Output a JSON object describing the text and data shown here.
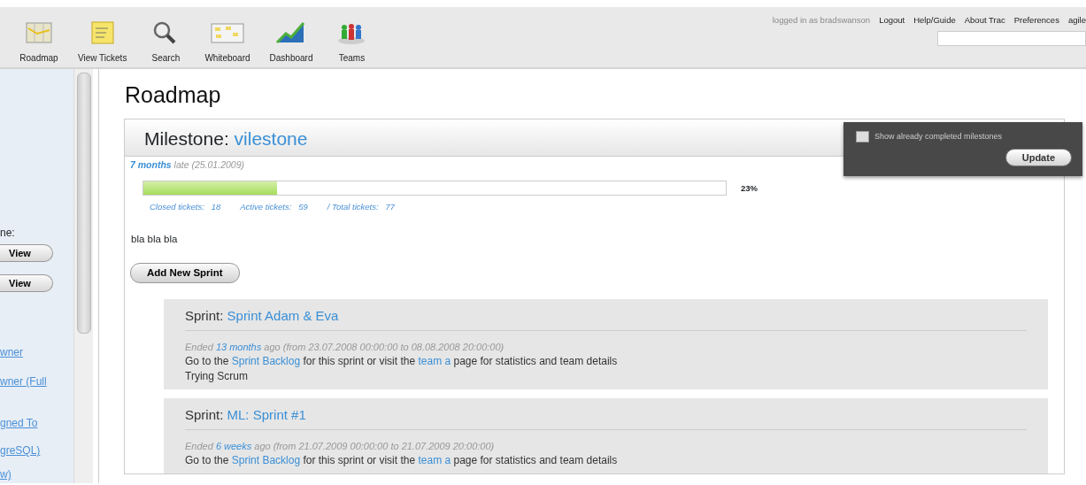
{
  "toolbar": {
    "items": [
      {
        "label": "Roadmap"
      },
      {
        "label": "View Tickets"
      },
      {
        "label": "Search"
      },
      {
        "label": "Whiteboard"
      },
      {
        "label": "Dashboard"
      },
      {
        "label": "Teams"
      }
    ]
  },
  "metanav": {
    "user": "logged in as bradswanson",
    "links": [
      "Logout",
      "Help/Guide",
      "About Trac",
      "Preferences",
      "agile"
    ]
  },
  "sidebar": {
    "label": "ne:",
    "buttons": [
      "View",
      "View"
    ],
    "links": [
      "wner",
      "wner (Full",
      "gned To",
      "greSQL)",
      "w)"
    ]
  },
  "page_title": "Roadmap",
  "milestone": {
    "label": "Milestone:",
    "name": "vilestone",
    "due_link": "7 months",
    "due_text": "late",
    "due_date": "(25.01.2009)",
    "level": 0.23,
    "percent": "23%",
    "stats": [
      {
        "label": "Closed tickets:",
        "value": "18"
      },
      {
        "label": "Active tickets:",
        "value": "59"
      },
      {
        "label": "/ Total tickets:",
        "value": "77"
      }
    ],
    "description": "bla bla bla",
    "add_button": "Add New Sprint"
  },
  "sprints": [
    {
      "label": "Sprint:",
      "name": "Sprint Adam & Eva",
      "ended": [
        "Ended ",
        "13 months",
        " ago (from 23.07.2008 00:00:00 to 08.08.2008 20:00:00)"
      ],
      "goto": [
        "Go to the ",
        "Sprint Backlog",
        " for this sprint or visit the ",
        "team a",
        " page for statistics and team details"
      ],
      "description": "Trying Scrum"
    },
    {
      "label": "Sprint:",
      "name": "ML: Sprint #1",
      "ended": [
        "Ended ",
        "6 weeks",
        " ago (from 21.07.2009 00:00:00 to 21.07.2009 20:00:00)"
      ],
      "goto": [
        "Go to the ",
        "Sprint Backlog",
        " for this sprint or visit the ",
        "team a",
        " page for statistics and team details"
      ]
    }
  ],
  "filter": {
    "checkbox_label": "Show already completed milestones",
    "checked": false,
    "button": "Update"
  }
}
